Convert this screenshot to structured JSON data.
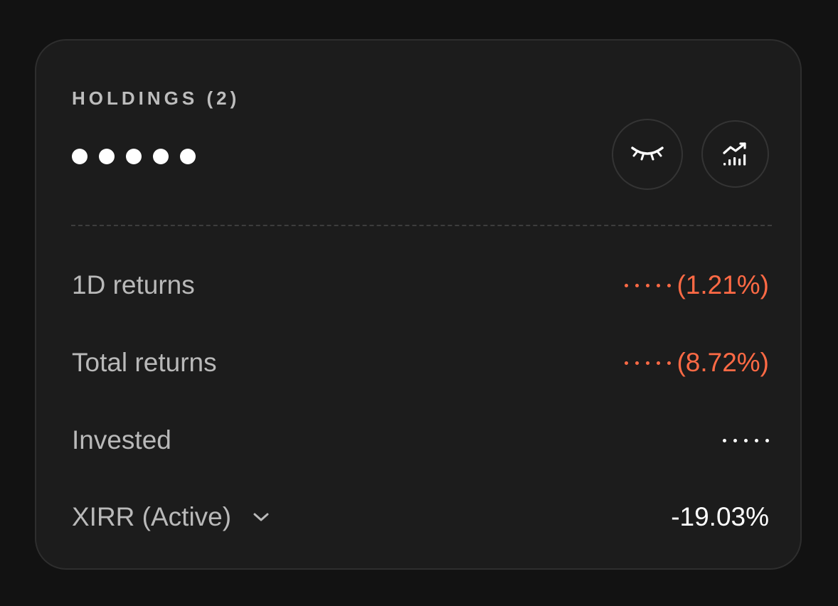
{
  "holdings": {
    "title": "HOLDINGS (2)",
    "value_mask": "●●●●●",
    "icons": {
      "visibility_toggle": "eye-closed-icon",
      "analytics": "analytics-chart-icon"
    }
  },
  "rows": [
    {
      "label": "1D returns",
      "masked": true,
      "value": "(1.21%)",
      "tone": "loss"
    },
    {
      "label": "Total returns",
      "masked": true,
      "value": "(8.72%)",
      "tone": "loss"
    },
    {
      "label": "Invested",
      "masked": true,
      "value": "",
      "tone": "neutral"
    },
    {
      "label": "XIRR (Active)",
      "masked": false,
      "value": "-19.03%",
      "tone": "neutral",
      "dropdown": true
    }
  ],
  "colors": {
    "background": "#121212",
    "card": "#1c1c1c",
    "loss": "#ff6a45",
    "label": "#b9b9b9",
    "primary_text": "#ffffff"
  }
}
